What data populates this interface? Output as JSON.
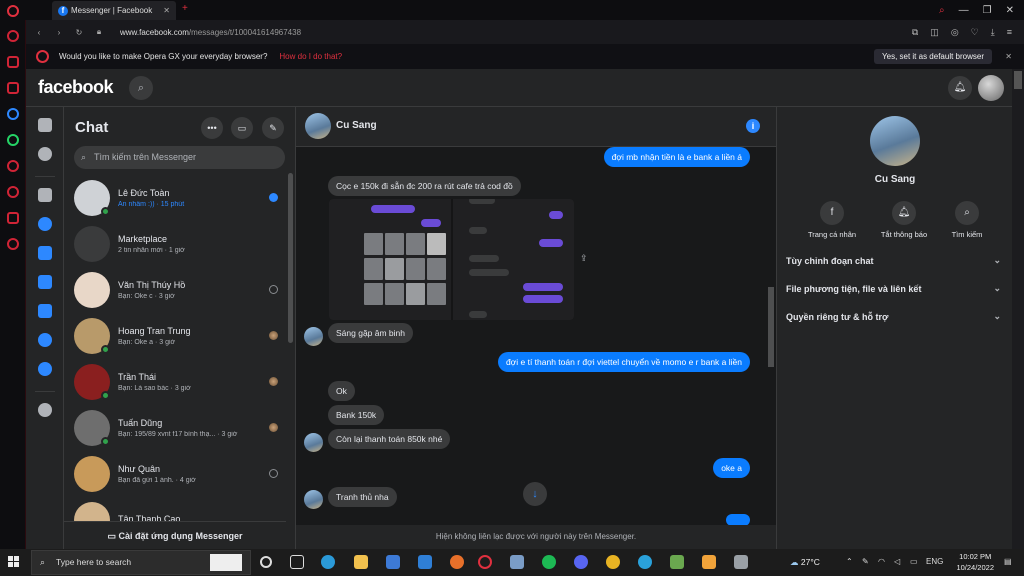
{
  "browser": {
    "tab_title": "Messenger | Facebook",
    "url_host": "www.facebook.com",
    "url_path": "/messages/t/100041614967438",
    "infobar_text": "Would you like to make Opera GX your everyday browser?",
    "infobar_link": "How do I do that?",
    "infobar_button": "Yes, set it as default browser",
    "accent": "#e0303f"
  },
  "header": {
    "logo": "facebook"
  },
  "chat": {
    "title": "Chat",
    "search_placeholder": "Tìm kiếm trên Messenger",
    "install_label": "Cài đặt ứng dụng Messenger",
    "conversations": [
      {
        "name": "Lê Đức Toàn",
        "preview": "Ấn nhầm :)) · 15 phút",
        "unread": true,
        "online": true,
        "avatar": "#cfd2d6"
      },
      {
        "name": "Marketplace",
        "preview": "2 tin nhắn mới · 1 giờ",
        "unread": false,
        "online": false,
        "avatar": "#3a3b3c"
      },
      {
        "name": "Văn Thị Thúy Hồ",
        "preview": "Bạn: Oke c · 3 giờ",
        "unread": false,
        "online": false,
        "avatar": "#e8d7c8"
      },
      {
        "name": "Hoang Tran Trung",
        "preview": "Bạn: Oke a · 3 giờ",
        "unread": false,
        "online": true,
        "avatar": "#b89a6a"
      },
      {
        "name": "Trần Thái",
        "preview": "Bạn: Là sao bác · 3 giờ",
        "unread": false,
        "online": true,
        "avatar": "#8a1f1f"
      },
      {
        "name": "Tuấn Dũng",
        "preview": "Bạn: 195/89 xvnt f17 bình thạ... · 3 giờ",
        "unread": false,
        "online": true,
        "avatar": "#6e6e6e"
      },
      {
        "name": "Như Quân",
        "preview": "Bạn đã gửi 1 ảnh. · 4 giờ",
        "unread": false,
        "online": false,
        "avatar": "#c89a5a"
      },
      {
        "name": "Tân Thanh Cao",
        "preview": "",
        "unread": false,
        "online": false,
        "avatar": "#d2b48c"
      }
    ]
  },
  "conversation": {
    "name": "Cu Sang",
    "notice": "Hiện không liên lạc được với người này trên Messenger.",
    "messages": {
      "m1": "đợi mb nhận tiền là e bank a liền á",
      "m2": "Cọc e 150k đi sẵn đc 200 ra rút cafe trả cod đồ",
      "m3": "Sáng gặp âm binh",
      "m4": "đợi e tí thanh toán r đợi viettel chuyển về momo e r bank a liền",
      "m5": "Ok",
      "m6": "Bank 150k",
      "m7": "Còn lại thanh toán 850k nhé",
      "m8": "oke a",
      "m9": "Tranh thủ nha"
    },
    "outgoing_color": "#0a7cff"
  },
  "info_panel": {
    "name": "Cu Sang",
    "actions": [
      "Trang cá nhân",
      "Tắt thông báo",
      "Tìm kiếm"
    ],
    "sections": [
      "Tùy chỉnh đoạn chat",
      "File phương tiện, file và liên kết",
      "Quyền riêng tư & hỗ trợ"
    ]
  },
  "taskbar": {
    "search_placeholder": "Type here to search",
    "weather": "27°C",
    "time": "10:02 PM",
    "date": "10/24/2022"
  }
}
